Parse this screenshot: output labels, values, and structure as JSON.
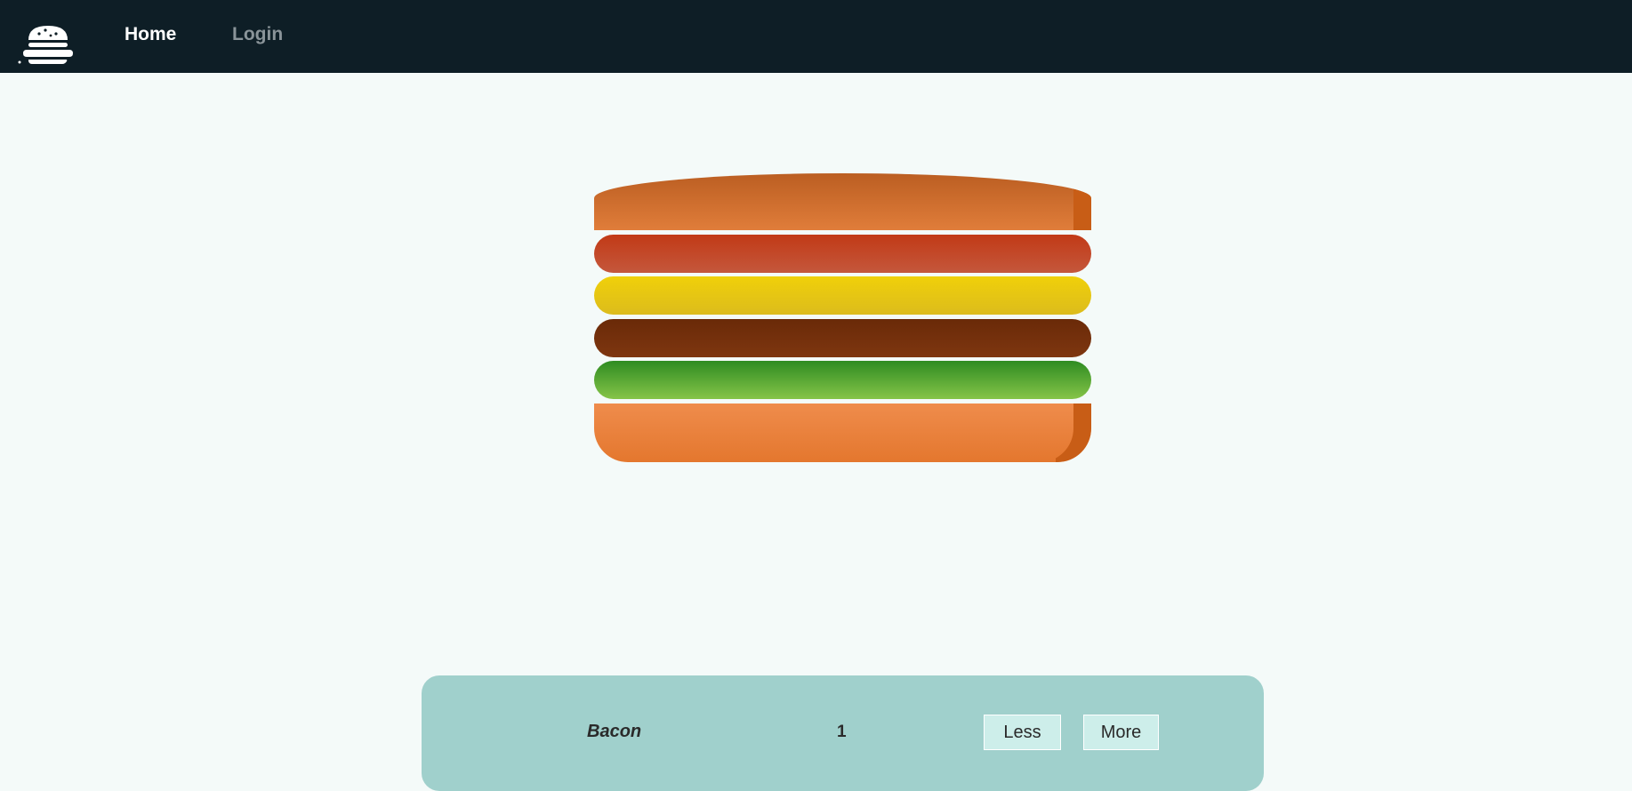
{
  "nav": {
    "logo_icon": "burger-logo-icon",
    "links": [
      {
        "label": "Home",
        "active": true
      },
      {
        "label": "Login",
        "active": false
      }
    ]
  },
  "burger": {
    "layers": [
      "bread-top",
      "bacon",
      "cheese",
      "meat",
      "salad",
      "bread-bottom"
    ]
  },
  "controls": {
    "ingredient_label": "Bacon",
    "count": "1",
    "less_label": "Less",
    "more_label": "More"
  },
  "colors": {
    "navbar": "#0e1e26",
    "background": "#f4faf9",
    "controls_panel": "#a0d0cc",
    "button_bg": "#cdeeea"
  }
}
